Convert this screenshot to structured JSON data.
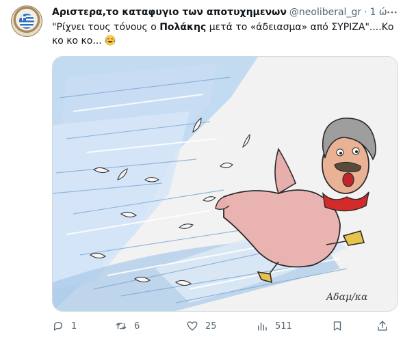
{
  "tweet": {
    "display_name": "Αριστερα,το καταφυγιο των αποτυχημενων",
    "handle": "@neoliberal_gr",
    "separator": "·",
    "time": "1 ώ",
    "text_before": "\"Ρίχνει τους τόνους ο ",
    "text_bold": "Πολάκης",
    "text_after": " μετά το «άδειασμα» από ΣΥΡΙΖΑ\"....Κο κο κο κο...",
    "emoji": "face-with-tears-of-joy",
    "media": {
      "description_icon": "caricature-illustration",
      "signature": "Αδαμ/κα"
    },
    "actions": {
      "replies": "1",
      "retweets": "6",
      "likes": "25",
      "views": "511"
    }
  },
  "colors": {
    "text": "#0f1419",
    "secondary": "#536471",
    "border": "#cfd9de"
  }
}
